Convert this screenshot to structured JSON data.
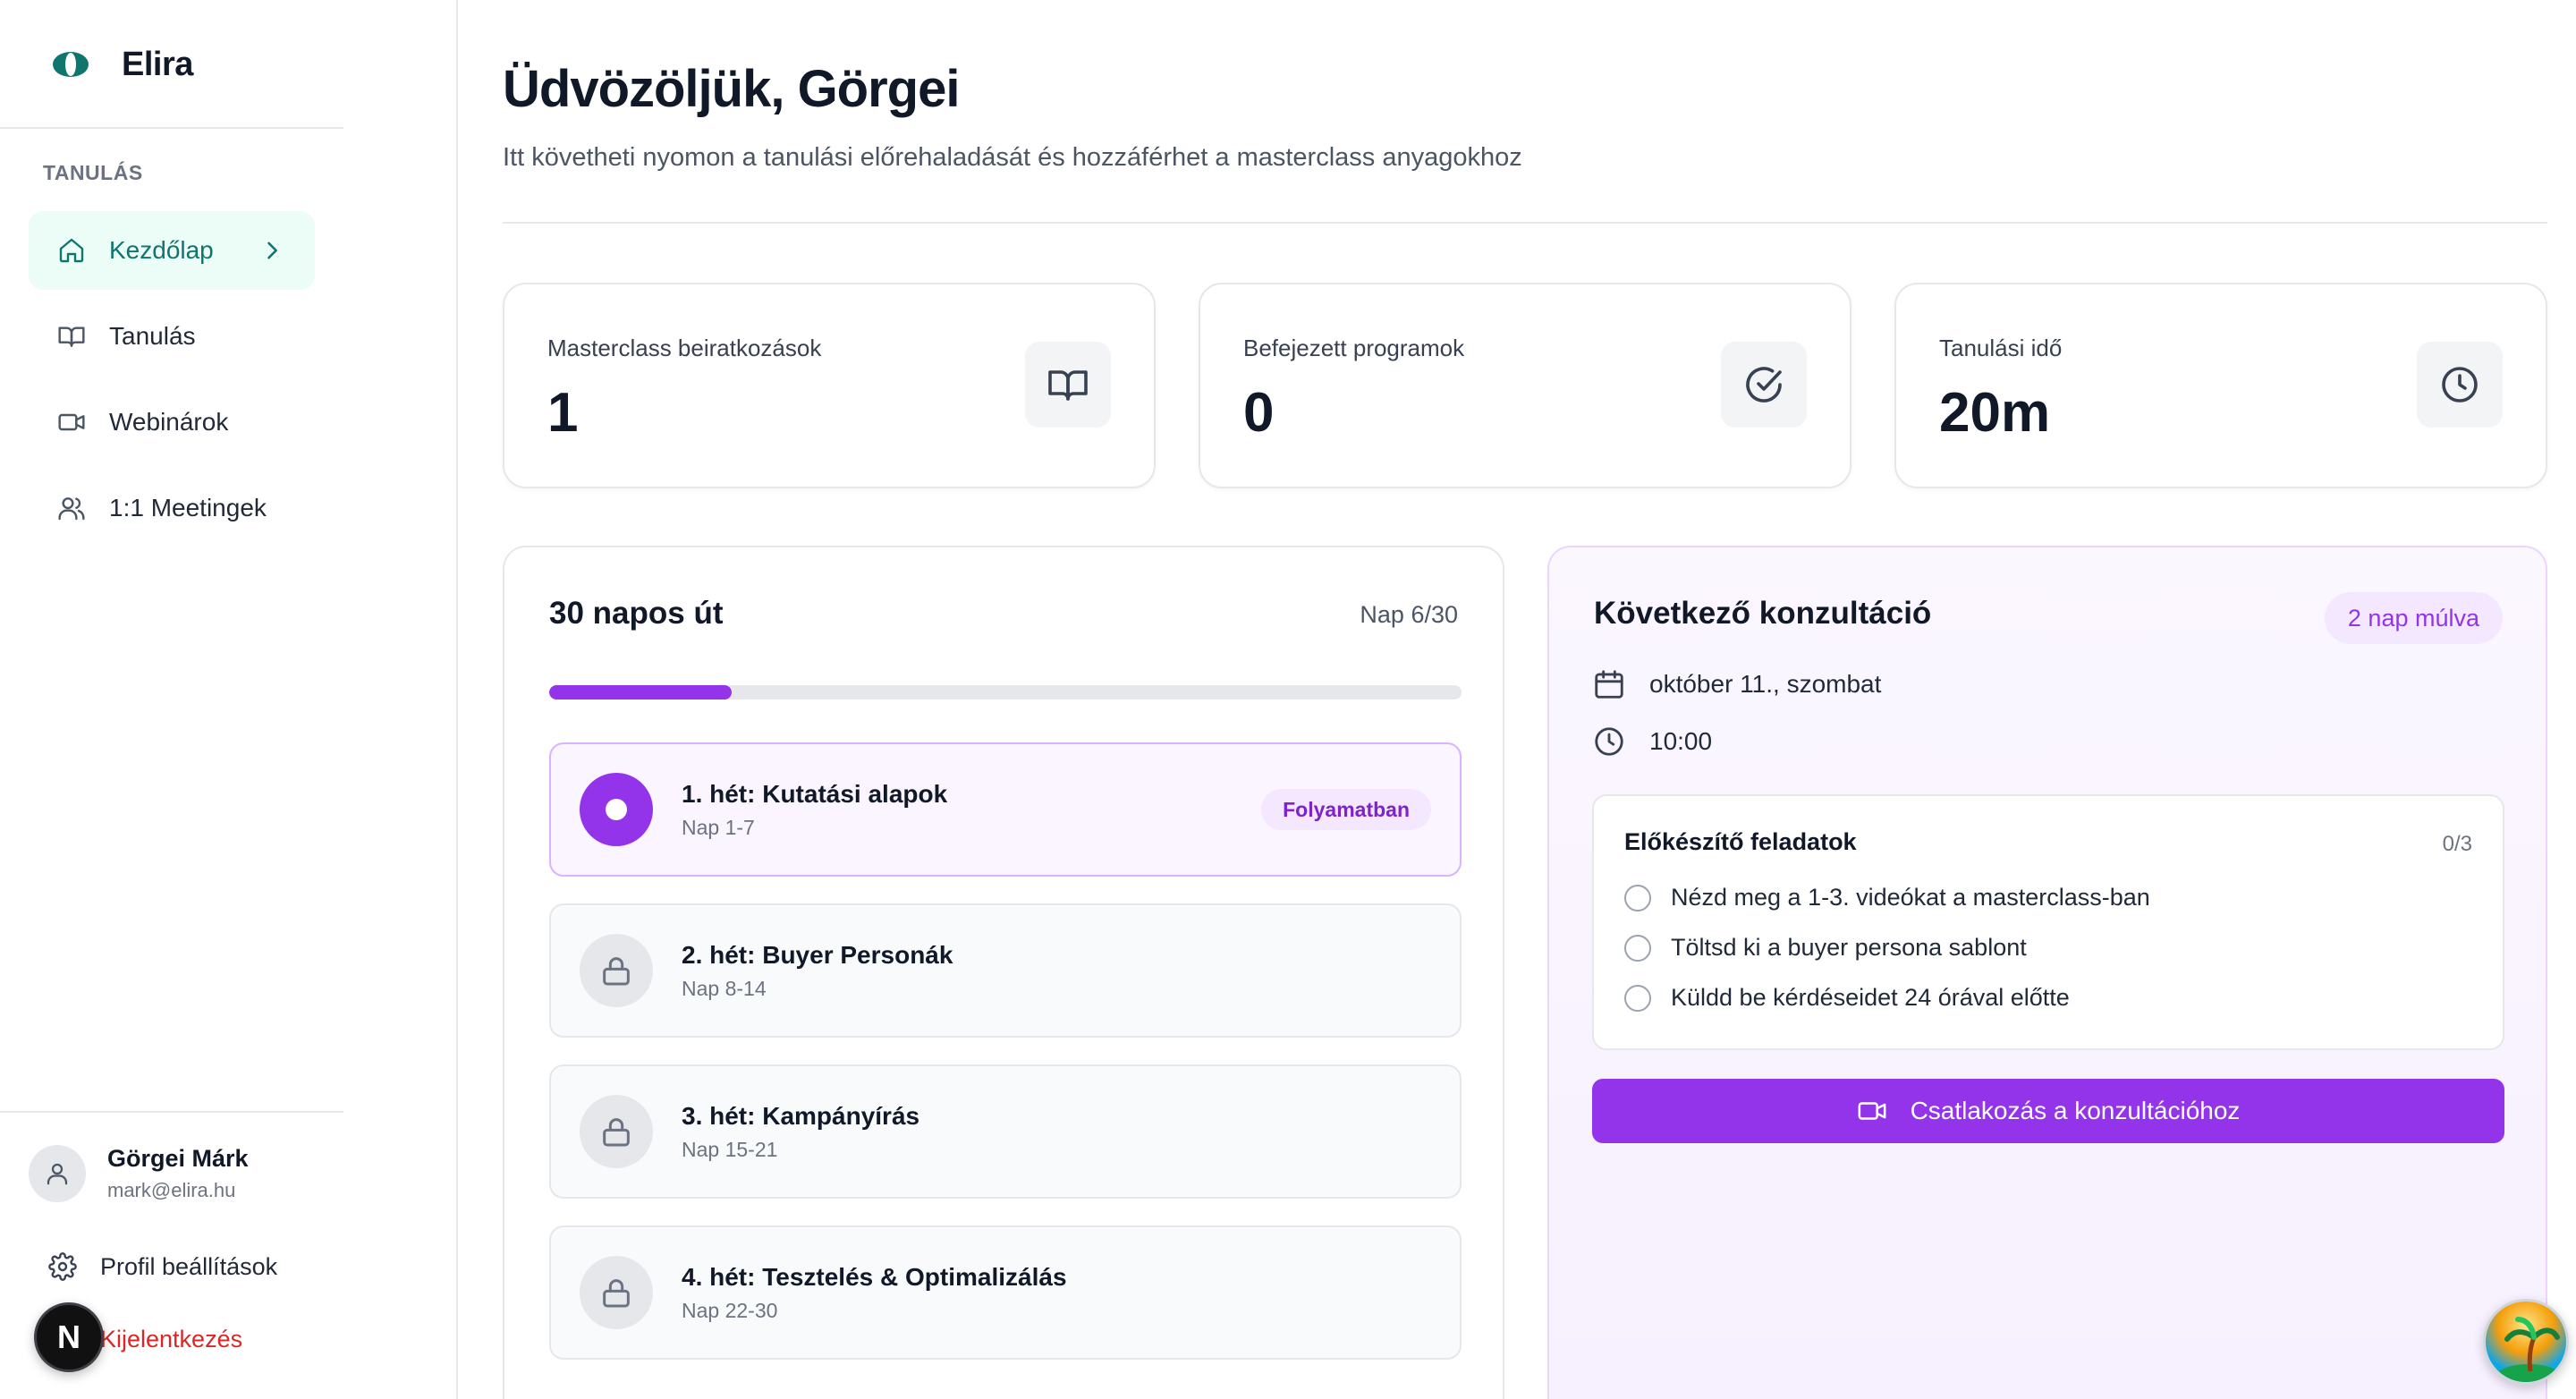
{
  "app": {
    "name": "Elira",
    "brand_color": "#0f766e",
    "accent_color": "#9333ea"
  },
  "sidebar": {
    "section_label": "TANULÁS",
    "items": [
      {
        "label": "Kezdőlap",
        "icon": "home-icon",
        "active": true
      },
      {
        "label": "Tanulás",
        "icon": "book-open-icon",
        "active": false
      },
      {
        "label": "Webinárok",
        "icon": "video-icon",
        "active": false
      },
      {
        "label": "1:1 Meetingek",
        "icon": "users-icon",
        "active": false
      }
    ],
    "user": {
      "name": "Görgei Márk",
      "email": "mark@elira.hu"
    },
    "profile_label": "Profil beállítások",
    "logout_label": "Kijelentkezés",
    "next_badge": "N"
  },
  "header": {
    "title": "Üdvözöljük, Görgei",
    "subtitle": "Itt követheti nyomon a tanulási előrehaladását és hozzáférhet a masterclass anyagokhoz"
  },
  "stats": [
    {
      "label": "Masterclass beiratkozások",
      "value": "1",
      "icon": "book-open-icon"
    },
    {
      "label": "Befejezett programok",
      "value": "0",
      "icon": "check-circle-icon"
    },
    {
      "label": "Tanulási idő",
      "value": "20m",
      "icon": "clock-icon"
    }
  ],
  "journey": {
    "title": "30 napos út",
    "day_counter": "Nap 6/30",
    "progress_fraction": 0.2,
    "weeks": [
      {
        "title": "1. hét: Kutatási alapok",
        "days": "Nap 1-7",
        "status": "current",
        "badge": "Folyamatban"
      },
      {
        "title": "2. hét: Buyer Personák",
        "days": "Nap 8-14",
        "status": "locked"
      },
      {
        "title": "3. hét: Kampányírás",
        "days": "Nap 15-21",
        "status": "locked"
      },
      {
        "title": "4. hét: Tesztelés & Optimalizálás",
        "days": "Nap 22-30",
        "status": "locked"
      }
    ]
  },
  "consultation": {
    "title": "Következő konzultáció",
    "badge": "2 nap múlva",
    "date": "október 11., szombat",
    "time": "10:00",
    "prep": {
      "title": "Előkészítő feladatok",
      "count": "0/3",
      "items": [
        "Nézd meg a 1-3. videókat a masterclass-ban",
        "Töltsd ki a buyer persona sablont",
        "Küldd be kérdéseidet 24 órával előtte"
      ]
    },
    "join_label": "Csatlakozás a konzultációhoz"
  }
}
